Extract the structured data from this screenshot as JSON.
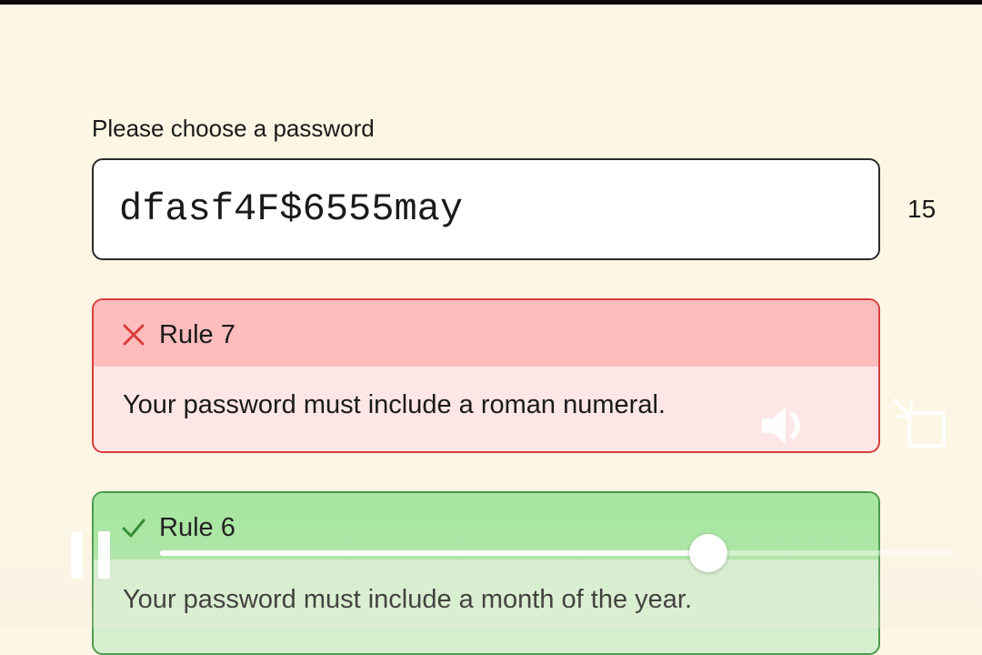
{
  "password_field": {
    "label": "Please choose a password",
    "value": "dfasf4F$6555may",
    "character_count": "15"
  },
  "rules": [
    {
      "title": "Rule 7",
      "description": "Your password must include a roman numeral.",
      "status": "failed",
      "icon": "cross-icon",
      "colors": {
        "header": "#fdbdbd",
        "body": "#fde6e6",
        "border": "#d83c3c",
        "icon": "#d83c3c"
      }
    },
    {
      "title": "Rule 6",
      "description": "Your password must include a month of the year.",
      "status": "passed",
      "icon": "check-icon",
      "colors": {
        "header": "#a8e6a1",
        "body": "#d5efce",
        "border": "#4a9a4a",
        "icon": "#2e8a2e"
      }
    }
  ],
  "video_overlay": {
    "playback_progress": 0.69,
    "icons": [
      "pause-icon",
      "speaker-icon",
      "screen-rotate-icon"
    ]
  },
  "colors": {
    "page_background": "#fdf6e4",
    "top_bar": "#0b0b0b"
  }
}
